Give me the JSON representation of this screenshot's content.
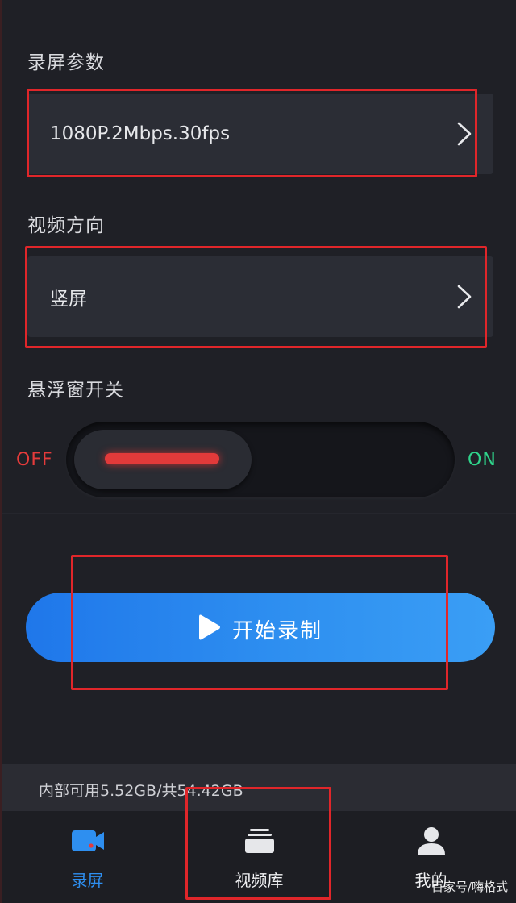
{
  "settings": {
    "record_params": {
      "label": "录屏参数",
      "value": "1080P.2Mbps.30fps"
    },
    "orientation": {
      "label": "视频方向",
      "value": "竖屏"
    },
    "floating_window": {
      "label": "悬浮窗开关",
      "off_label": "OFF",
      "on_label": "ON",
      "state": "off"
    }
  },
  "record_button": {
    "label": "开始录制"
  },
  "storage": {
    "text": "内部可用5.52GB/共54.42GB"
  },
  "tabs": [
    {
      "label": "录屏",
      "icon": "video-camera-icon",
      "active": true
    },
    {
      "label": "视频库",
      "icon": "video-library-icon",
      "active": false
    },
    {
      "label": "我的",
      "icon": "user-icon",
      "active": false
    }
  ],
  "colors": {
    "accent": "#2e8ff0",
    "off": "#e53b3b",
    "on": "#2fd48b",
    "highlight": "#e0262a"
  },
  "watermark": "百家号/嗨格式"
}
